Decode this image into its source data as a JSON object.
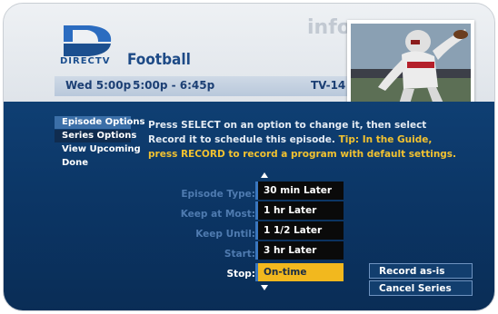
{
  "brand": {
    "logo_text": "DIRECTV"
  },
  "watermark": "info",
  "program": {
    "title": "Football",
    "day_time": "Wed 5:00p",
    "time_range": "5:00p - 6:45p",
    "rating": "TV-14"
  },
  "side_menu": [
    {
      "label": "Episode Options",
      "state": "active"
    },
    {
      "label": "Series Options",
      "state": "selected"
    },
    {
      "label": "View Upcoming",
      "state": ""
    },
    {
      "label": "Done",
      "state": ""
    }
  ],
  "help": {
    "text": "Press SELECT on an option to change it, then select Record it to schedule this episode.",
    "tip": "Tip: In the Guide, press RECORD to record a program with default settings."
  },
  "options": {
    "episode_type": "Episode Type:",
    "keep_at_most": "Keep at Most:",
    "keep_until": "Keep Until:",
    "start": "Start:",
    "stop": "Stop:"
  },
  "dropdown": {
    "items": [
      "30 min Later",
      "1 hr Later",
      "1 1/2 Later",
      "3 hr Later",
      "On-time"
    ],
    "selected": "On-time"
  },
  "actions": {
    "record": "Record as-is",
    "cancel": "Cancel Series"
  },
  "colors": {
    "panel": "#0b3463",
    "accent": "#f2b81e",
    "tip": "#f2c230",
    "brand": "#1c4f8f"
  },
  "icons": {
    "logo": "directv-logo-icon",
    "scroll_up": "arrow-up-icon",
    "scroll_down": "arrow-down-icon"
  }
}
